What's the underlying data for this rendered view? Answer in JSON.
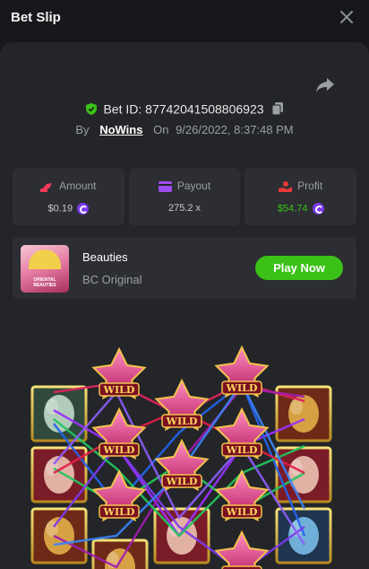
{
  "header": {
    "title": "Bet Slip"
  },
  "bet": {
    "id_label": "Bet ID:",
    "id_value": "87742041508806923",
    "by_label": "By",
    "username": "NoWins",
    "on_label": "On",
    "datetime": "9/26/2022, 8:37:48 PM"
  },
  "stats": {
    "amount": {
      "label": "Amount",
      "value": "$0.19"
    },
    "payout": {
      "label": "Payout",
      "value": "275.2 x"
    },
    "profit": {
      "label": "Profit",
      "value": "$54.74"
    }
  },
  "game": {
    "name": "Beauties",
    "provider": "BC Original",
    "thumb_text_1": "ORIENTAL",
    "thumb_text_2": "BEAUTIES",
    "play_label": "Play Now"
  },
  "reels": {
    "wild_text": "WILD"
  },
  "colors": {
    "accent_green": "#3bc117",
    "coin_purple": "#7c3aed"
  }
}
